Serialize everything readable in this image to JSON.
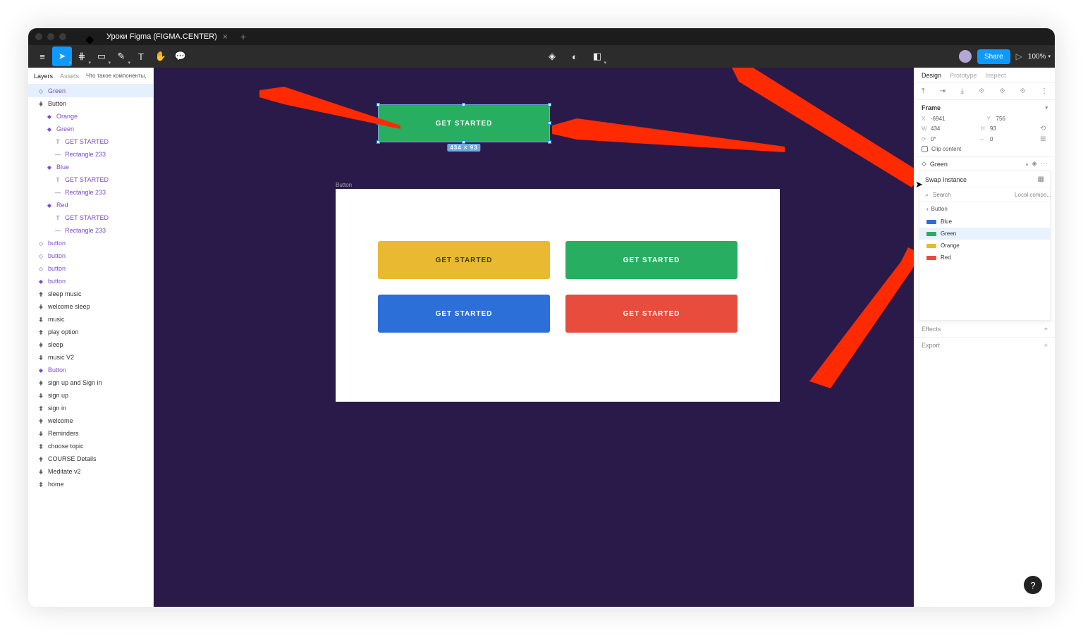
{
  "window_tab": "Уроки Figma (FIGMA.CENTER)",
  "toolbar": {
    "share": "Share",
    "zoom": "100%"
  },
  "left": {
    "tabs": {
      "layers": "Layers",
      "assets": "Assets"
    },
    "page": "Что такое компоненты, как с...",
    "layers": [
      {
        "label": "Green",
        "icon": "◇",
        "indent": 0,
        "purple": true,
        "selected": true
      },
      {
        "label": "Button",
        "icon": "⋕",
        "indent": 0
      },
      {
        "label": "Orange",
        "icon": "◆",
        "indent": 1,
        "purple": true
      },
      {
        "label": "Green",
        "icon": "◆",
        "indent": 1,
        "purple": true
      },
      {
        "label": "GET STARTED",
        "icon": "T",
        "indent": 2,
        "purple": true
      },
      {
        "label": "Rectangle 233",
        "icon": "—",
        "indent": 2,
        "purple": true
      },
      {
        "label": "Blue",
        "icon": "◆",
        "indent": 1,
        "purple": true
      },
      {
        "label": "GET STARTED",
        "icon": "T",
        "indent": 2,
        "purple": true
      },
      {
        "label": "Rectangle 233",
        "icon": "—",
        "indent": 2,
        "purple": true
      },
      {
        "label": "Red",
        "icon": "◆",
        "indent": 1,
        "purple": true
      },
      {
        "label": "GET STARTED",
        "icon": "T",
        "indent": 2,
        "purple": true
      },
      {
        "label": "Rectangle 233",
        "icon": "—",
        "indent": 2,
        "purple": true
      },
      {
        "label": "button",
        "icon": "◇",
        "indent": 0,
        "purple": true
      },
      {
        "label": "button",
        "icon": "◇",
        "indent": 0,
        "purple": true
      },
      {
        "label": "button",
        "icon": "◇",
        "indent": 0,
        "purple": true
      },
      {
        "label": "button",
        "icon": "◆",
        "indent": 0,
        "purple": true
      },
      {
        "label": "sleep music",
        "icon": "⋕",
        "indent": 0
      },
      {
        "label": "welcome sleep",
        "icon": "⋕",
        "indent": 0
      },
      {
        "label": "music",
        "icon": "⋕",
        "indent": 0
      },
      {
        "label": "play option",
        "icon": "⋕",
        "indent": 0
      },
      {
        "label": "sleep",
        "icon": "⋕",
        "indent": 0
      },
      {
        "label": "music V2",
        "icon": "⋕",
        "indent": 0
      },
      {
        "label": "Button",
        "icon": "◆",
        "indent": 0,
        "purple": true
      },
      {
        "label": "sign up and Sign in",
        "icon": "⋕",
        "indent": 0
      },
      {
        "label": "sign up",
        "icon": "⋕",
        "indent": 0
      },
      {
        "label": "sign in",
        "icon": "⋕",
        "indent": 0
      },
      {
        "label": "welcome",
        "icon": "⋕",
        "indent": 0
      },
      {
        "label": "Reminders",
        "icon": "⋕",
        "indent": 0
      },
      {
        "label": "choose topic",
        "icon": "⋕",
        "indent": 0
      },
      {
        "label": "COURSE Details",
        "icon": "⋕",
        "indent": 0
      },
      {
        "label": "Meditate v2",
        "icon": "⋕",
        "indent": 0
      },
      {
        "label": "home",
        "icon": "⋕",
        "indent": 0
      }
    ]
  },
  "canvas": {
    "top_instance_label": "GET STARTED",
    "dim": "434 × 93",
    "frame_label": "Button",
    "buttons": [
      {
        "label": "GET STARTED",
        "class": "c-yellow"
      },
      {
        "label": "GET STARTED",
        "class": "c-green"
      },
      {
        "label": "GET STARTED",
        "class": "c-blue"
      },
      {
        "label": "GET STARTED",
        "class": "c-red"
      }
    ]
  },
  "right": {
    "tabs": {
      "design": "Design",
      "prototype": "Prototype",
      "inspect": "Inspect"
    },
    "frame_title": "Frame",
    "x": "-6941",
    "y": "756",
    "w": "434",
    "h": "93",
    "r_angle": "0°",
    "r_radius": "0",
    "clip": "Clip content",
    "component_name": "Green",
    "swap_title": "Swap Instance",
    "search_placeholder": "Search",
    "local": "Local compo...",
    "crumb": "Button",
    "variants": [
      {
        "name": "Blue",
        "cls": "sw-blue"
      },
      {
        "name": "Green",
        "cls": "sw-green",
        "selected": true
      },
      {
        "name": "Orange",
        "cls": "sw-orange"
      },
      {
        "name": "Red",
        "cls": "sw-red"
      }
    ],
    "effects": "Effects",
    "export": "Export"
  }
}
